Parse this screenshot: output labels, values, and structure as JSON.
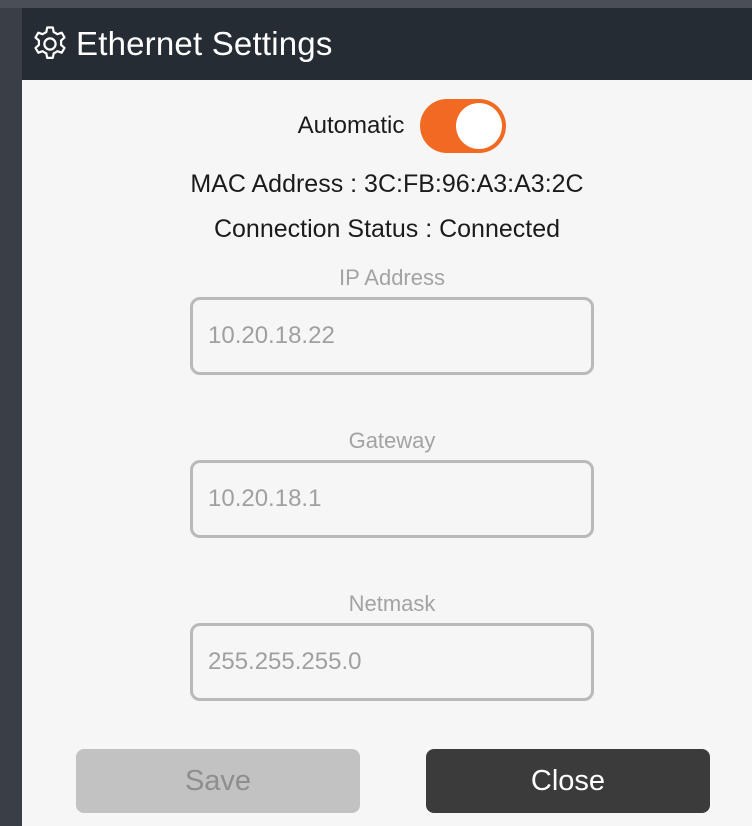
{
  "dialog": {
    "title": "Ethernet Settings",
    "title_icon": "gear-icon"
  },
  "automatic": {
    "label": "Automatic",
    "enabled": true,
    "accent_color": "#f26a22"
  },
  "info": {
    "mac": "MAC Address : 3C:FB:96:A3:A3:2C",
    "status": "Connection Status : Connected"
  },
  "fields": {
    "ip": {
      "label": "IP Address",
      "value": "10.20.18.22"
    },
    "gateway": {
      "label": "Gateway",
      "value": "10.20.18.1"
    },
    "netmask": {
      "label": "Netmask",
      "value": "255.255.255.0"
    }
  },
  "buttons": {
    "save": "Save",
    "close": "Close"
  },
  "colors": {
    "titlebar": "#262c33",
    "dialog_bg": "#f6f6f6",
    "close_button": "#3b3b3b",
    "save_button_disabled": "#c2c2c2"
  }
}
